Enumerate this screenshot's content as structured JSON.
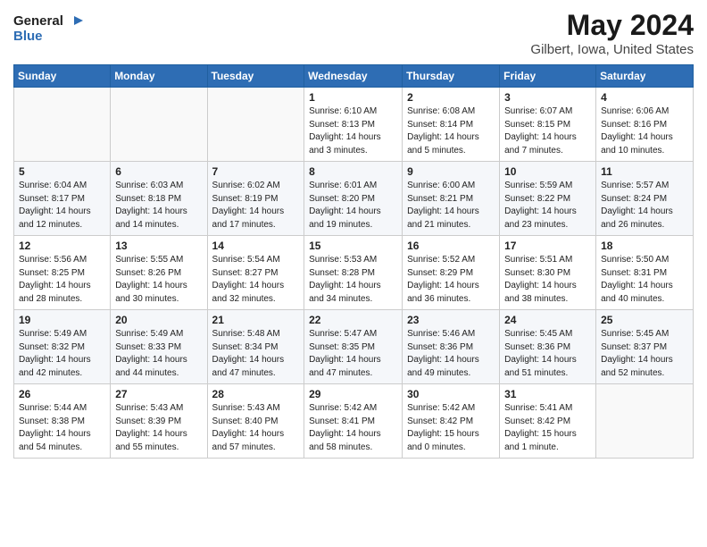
{
  "header": {
    "logo_general": "General",
    "logo_blue": "Blue",
    "title": "May 2024",
    "subtitle": "Gilbert, Iowa, United States"
  },
  "days_of_week": [
    "Sunday",
    "Monday",
    "Tuesday",
    "Wednesday",
    "Thursday",
    "Friday",
    "Saturday"
  ],
  "weeks": [
    [
      {
        "day": "",
        "info": ""
      },
      {
        "day": "",
        "info": ""
      },
      {
        "day": "",
        "info": ""
      },
      {
        "day": "1",
        "info": "Sunrise: 6:10 AM\nSunset: 8:13 PM\nDaylight: 14 hours\nand 3 minutes."
      },
      {
        "day": "2",
        "info": "Sunrise: 6:08 AM\nSunset: 8:14 PM\nDaylight: 14 hours\nand 5 minutes."
      },
      {
        "day": "3",
        "info": "Sunrise: 6:07 AM\nSunset: 8:15 PM\nDaylight: 14 hours\nand 7 minutes."
      },
      {
        "day": "4",
        "info": "Sunrise: 6:06 AM\nSunset: 8:16 PM\nDaylight: 14 hours\nand 10 minutes."
      }
    ],
    [
      {
        "day": "5",
        "info": "Sunrise: 6:04 AM\nSunset: 8:17 PM\nDaylight: 14 hours\nand 12 minutes."
      },
      {
        "day": "6",
        "info": "Sunrise: 6:03 AM\nSunset: 8:18 PM\nDaylight: 14 hours\nand 14 minutes."
      },
      {
        "day": "7",
        "info": "Sunrise: 6:02 AM\nSunset: 8:19 PM\nDaylight: 14 hours\nand 17 minutes."
      },
      {
        "day": "8",
        "info": "Sunrise: 6:01 AM\nSunset: 8:20 PM\nDaylight: 14 hours\nand 19 minutes."
      },
      {
        "day": "9",
        "info": "Sunrise: 6:00 AM\nSunset: 8:21 PM\nDaylight: 14 hours\nand 21 minutes."
      },
      {
        "day": "10",
        "info": "Sunrise: 5:59 AM\nSunset: 8:22 PM\nDaylight: 14 hours\nand 23 minutes."
      },
      {
        "day": "11",
        "info": "Sunrise: 5:57 AM\nSunset: 8:24 PM\nDaylight: 14 hours\nand 26 minutes."
      }
    ],
    [
      {
        "day": "12",
        "info": "Sunrise: 5:56 AM\nSunset: 8:25 PM\nDaylight: 14 hours\nand 28 minutes."
      },
      {
        "day": "13",
        "info": "Sunrise: 5:55 AM\nSunset: 8:26 PM\nDaylight: 14 hours\nand 30 minutes."
      },
      {
        "day": "14",
        "info": "Sunrise: 5:54 AM\nSunset: 8:27 PM\nDaylight: 14 hours\nand 32 minutes."
      },
      {
        "day": "15",
        "info": "Sunrise: 5:53 AM\nSunset: 8:28 PM\nDaylight: 14 hours\nand 34 minutes."
      },
      {
        "day": "16",
        "info": "Sunrise: 5:52 AM\nSunset: 8:29 PM\nDaylight: 14 hours\nand 36 minutes."
      },
      {
        "day": "17",
        "info": "Sunrise: 5:51 AM\nSunset: 8:30 PM\nDaylight: 14 hours\nand 38 minutes."
      },
      {
        "day": "18",
        "info": "Sunrise: 5:50 AM\nSunset: 8:31 PM\nDaylight: 14 hours\nand 40 minutes."
      }
    ],
    [
      {
        "day": "19",
        "info": "Sunrise: 5:49 AM\nSunset: 8:32 PM\nDaylight: 14 hours\nand 42 minutes."
      },
      {
        "day": "20",
        "info": "Sunrise: 5:49 AM\nSunset: 8:33 PM\nDaylight: 14 hours\nand 44 minutes."
      },
      {
        "day": "21",
        "info": "Sunrise: 5:48 AM\nSunset: 8:34 PM\nDaylight: 14 hours\nand 47 minutes."
      },
      {
        "day": "22",
        "info": "Sunrise: 5:47 AM\nSunset: 8:35 PM\nDaylight: 14 hours\nand 47 minutes."
      },
      {
        "day": "23",
        "info": "Sunrise: 5:46 AM\nSunset: 8:36 PM\nDaylight: 14 hours\nand 49 minutes."
      },
      {
        "day": "24",
        "info": "Sunrise: 5:45 AM\nSunset: 8:36 PM\nDaylight: 14 hours\nand 51 minutes."
      },
      {
        "day": "25",
        "info": "Sunrise: 5:45 AM\nSunset: 8:37 PM\nDaylight: 14 hours\nand 52 minutes."
      }
    ],
    [
      {
        "day": "26",
        "info": "Sunrise: 5:44 AM\nSunset: 8:38 PM\nDaylight: 14 hours\nand 54 minutes."
      },
      {
        "day": "27",
        "info": "Sunrise: 5:43 AM\nSunset: 8:39 PM\nDaylight: 14 hours\nand 55 minutes."
      },
      {
        "day": "28",
        "info": "Sunrise: 5:43 AM\nSunset: 8:40 PM\nDaylight: 14 hours\nand 57 minutes."
      },
      {
        "day": "29",
        "info": "Sunrise: 5:42 AM\nSunset: 8:41 PM\nDaylight: 14 hours\nand 58 minutes."
      },
      {
        "day": "30",
        "info": "Sunrise: 5:42 AM\nSunset: 8:42 PM\nDaylight: 15 hours\nand 0 minutes."
      },
      {
        "day": "31",
        "info": "Sunrise: 5:41 AM\nSunset: 8:42 PM\nDaylight: 15 hours\nand 1 minute."
      },
      {
        "day": "",
        "info": ""
      }
    ]
  ]
}
